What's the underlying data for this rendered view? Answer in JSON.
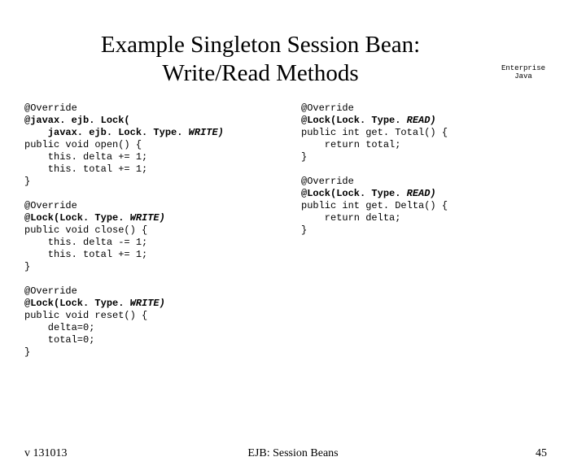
{
  "title_line1": "Example Singleton Session Bean:",
  "title_line2": "Write/Read Methods",
  "corner_line1": "Enterprise",
  "corner_line2": "Java",
  "left": {
    "b1_l1": "@Override",
    "b1_l2": "@javax. ejb. Lock(",
    "b1_l3": "    javax. ejb. Lock. Type. ",
    "b1_l3_em": "WRITE)",
    "b1_l4": "public void open() {",
    "b1_l5": "    this. delta += 1;",
    "b1_l6": "    this. total += 1;",
    "b1_l7": "}",
    "b2_l1": "@Override",
    "b2_l2a": "@Lock(Lock. Type. ",
    "b2_l2b": "WRITE)",
    "b2_l3": "public void close() {",
    "b2_l4": "    this. delta -= 1;",
    "b2_l5": "    this. total += 1;",
    "b2_l6": "}",
    "b3_l1": "@Override",
    "b3_l2a": "@Lock(Lock. Type. ",
    "b3_l2b": "WRITE)",
    "b3_l3": "public void reset() {",
    "b3_l4": "    delta=0;",
    "b3_l5": "    total=0;",
    "b3_l6": "}"
  },
  "right": {
    "b1_l1": "@Override",
    "b1_l2a": "@Lock(Lock. Type. ",
    "b1_l2b": "READ)",
    "b1_l3": "public int get. Total() {",
    "b1_l4": "    return total;",
    "b1_l5": "}",
    "b2_l1": "@Override",
    "b2_l2a": "@Lock(Lock. Type. ",
    "b2_l2b": "READ)",
    "b2_l3": "public int get. Delta() {",
    "b2_l4": "    return delta;",
    "b2_l5": "}"
  },
  "footer_left": "v 131013",
  "footer_center": "EJB: Session Beans",
  "footer_right": "45"
}
